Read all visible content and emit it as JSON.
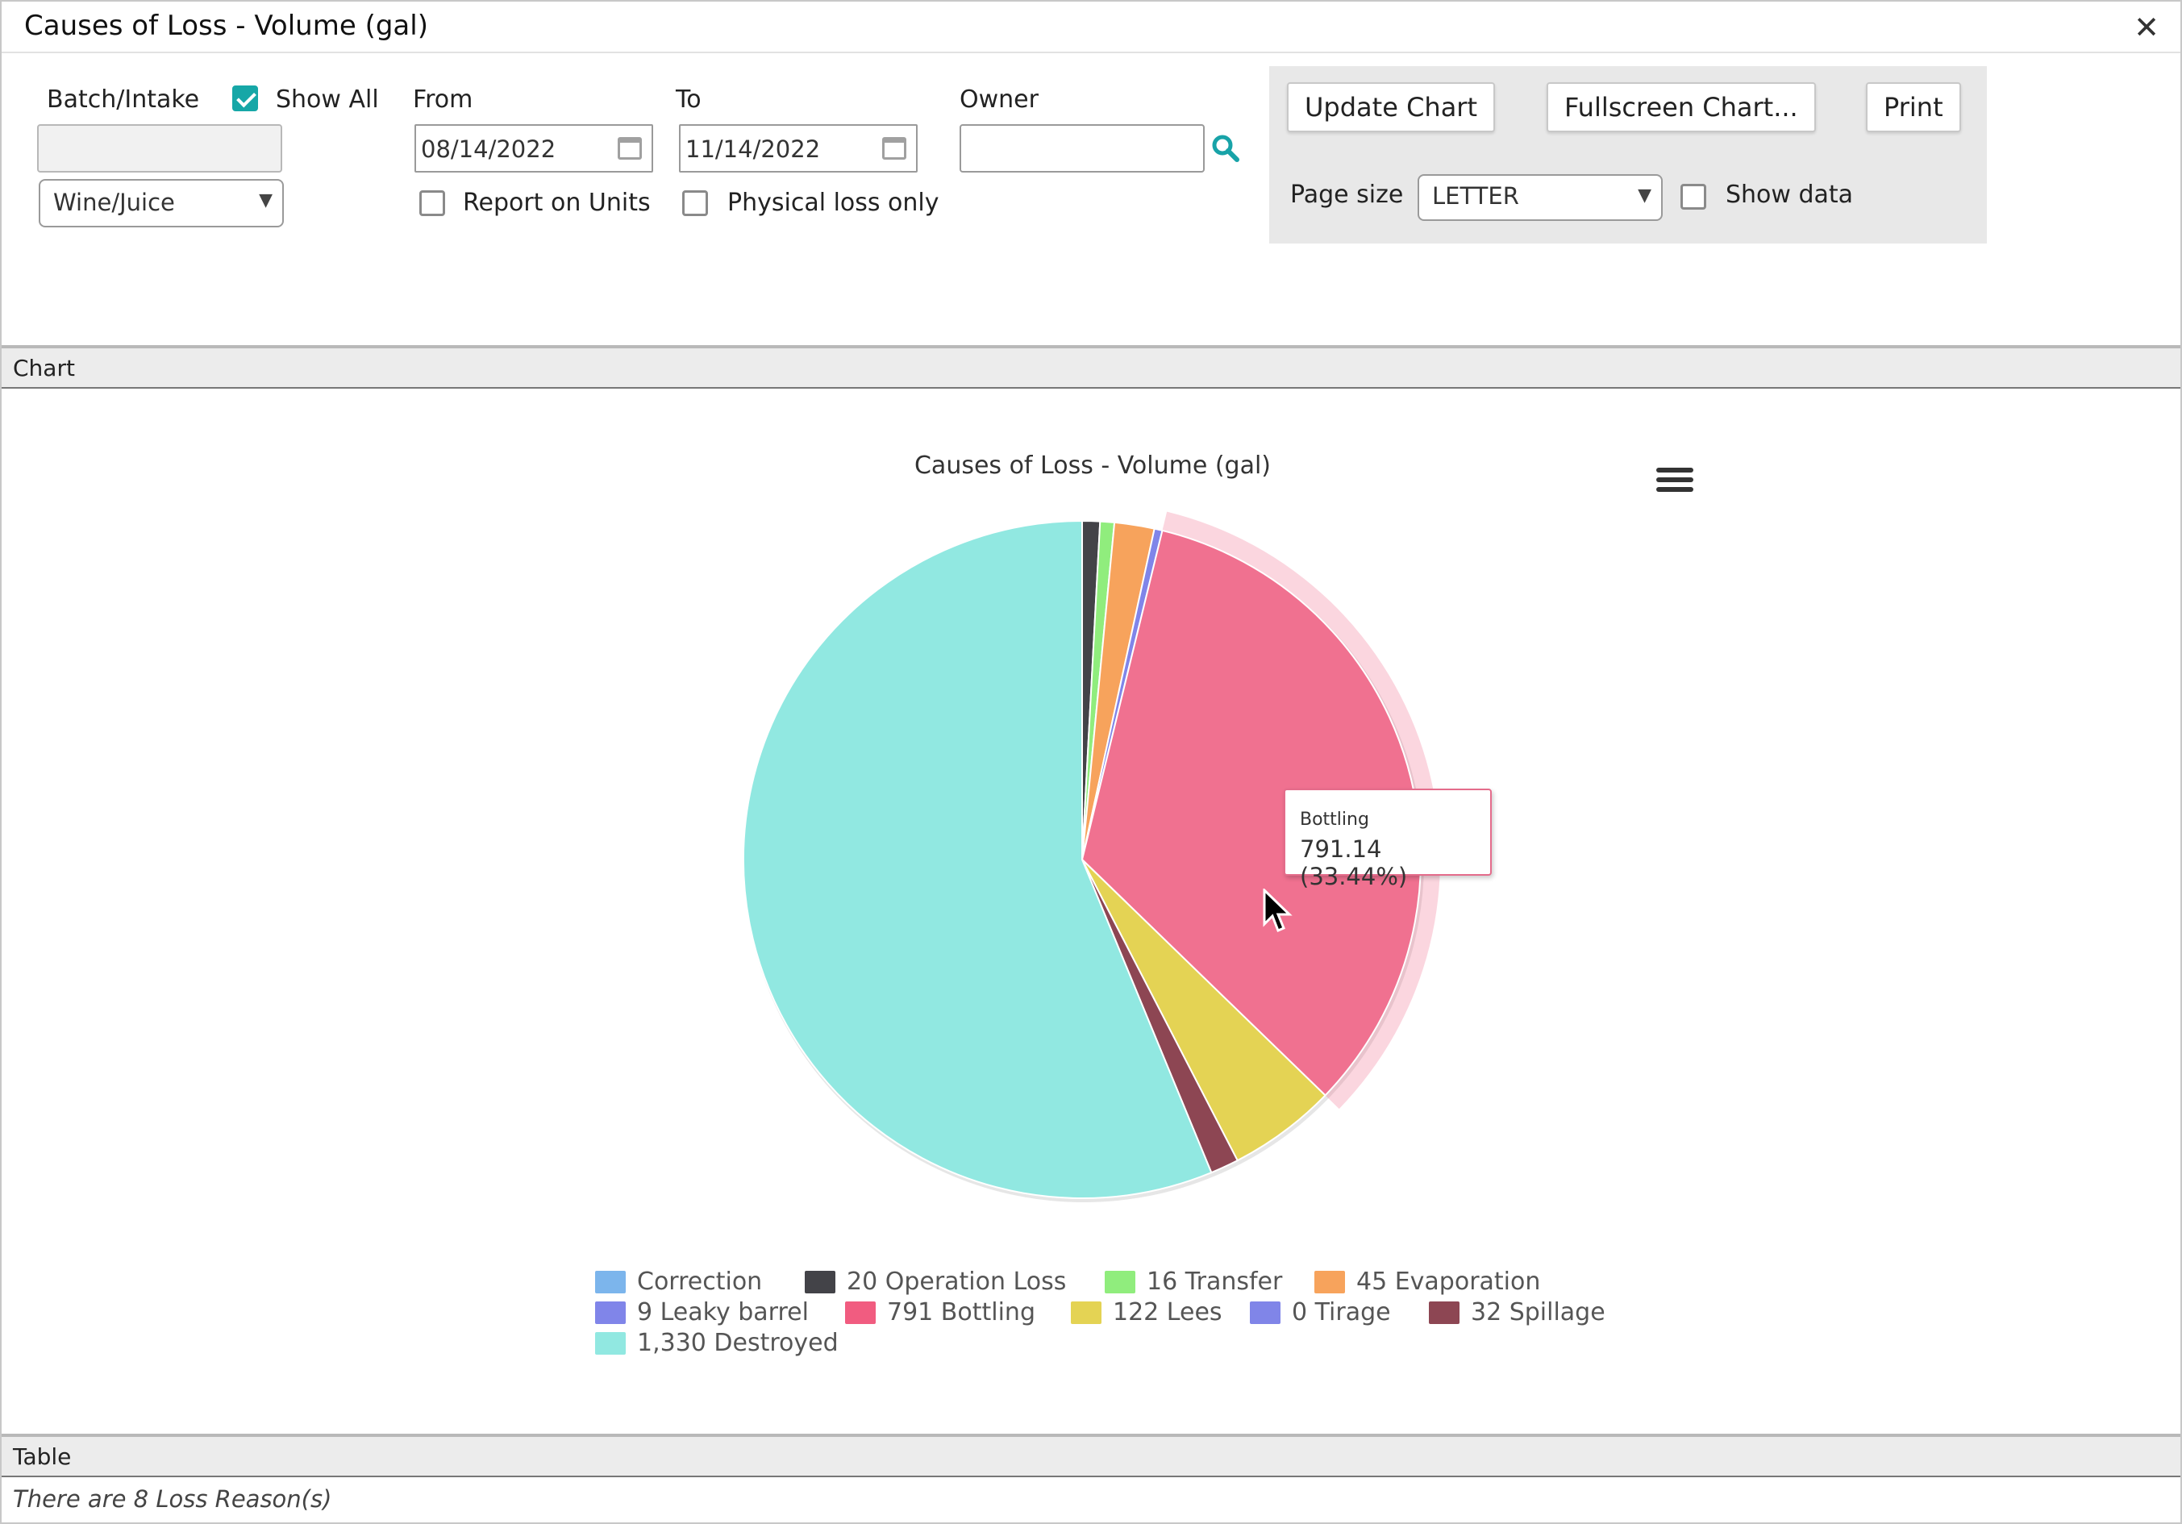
{
  "window": {
    "title": "Causes of Loss - Volume (gal)",
    "close_glyph": "✕"
  },
  "filters": {
    "batch_label": "Batch/Intake",
    "show_all_label": "Show All",
    "show_all_checked": true,
    "batch_value": "",
    "type_selected": "Wine/Juice",
    "from_label": "From",
    "from_value": "08/14/2022",
    "to_label": "To",
    "to_value": "11/14/2022",
    "owner_label": "Owner",
    "owner_value": "",
    "report_units_label": "Report on Units",
    "report_units_checked": false,
    "physical_loss_label": "Physical loss only",
    "physical_loss_checked": false
  },
  "actions": {
    "update_chart": "Update Chart",
    "fullscreen_chart": "Fullscreen Chart...",
    "print": "Print",
    "page_size_label": "Page size",
    "page_size_value": "LETTER",
    "show_data_label": "Show data",
    "show_data_checked": false
  },
  "sections": {
    "chart": "Chart",
    "table": "Table"
  },
  "tooltip": {
    "name": "Bottling",
    "value": "791.14 (33.44%)"
  },
  "table_info": "There are 8 Loss Reason(s)",
  "chart_data": {
    "type": "pie",
    "title": "Causes of Loss - Volume (gal)",
    "legend_position": "bottom",
    "slices": [
      {
        "name": "Correction",
        "value": 0,
        "label": "Correction",
        "color": "#7cb5ec"
      },
      {
        "name": "Operation Loss",
        "value": 20,
        "label": "20 Operation Loss",
        "color": "#434348"
      },
      {
        "name": "Transfer",
        "value": 16,
        "label": "16 Transfer",
        "color": "#90ed7d"
      },
      {
        "name": "Evaporation",
        "value": 45,
        "label": "45 Evaporation",
        "color": "#f7a35c"
      },
      {
        "name": "Leaky barrel",
        "value": 9,
        "label": "9 Leaky barrel",
        "color": "#8085e9"
      },
      {
        "name": "Bottling",
        "value": 791.14,
        "label": "791 Bottling",
        "color": "#f15c80",
        "hovered": true
      },
      {
        "name": "Lees",
        "value": 122,
        "label": "122 Lees",
        "color": "#e4d354"
      },
      {
        "name": "Tirage",
        "value": 0,
        "label": "0 Tirage",
        "color": "#8085e8"
      },
      {
        "name": "Spillage",
        "value": 32,
        "label": "32 Spillage",
        "color": "#8d4653"
      },
      {
        "name": "Destroyed",
        "value": 1330,
        "label": "1,330 Destroyed",
        "color": "#91e8e1"
      }
    ]
  }
}
